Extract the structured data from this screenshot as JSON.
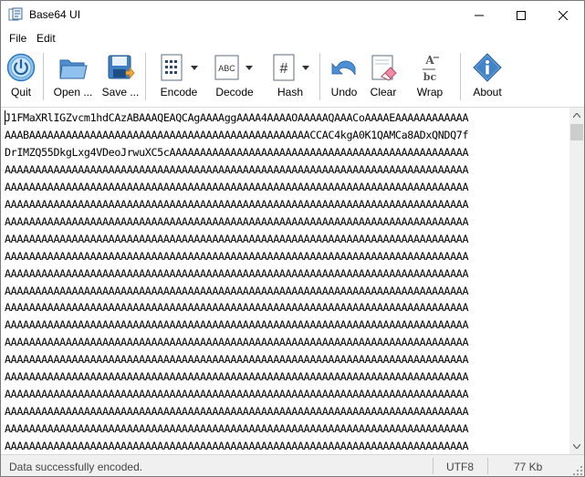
{
  "window": {
    "title": "Base64 UI",
    "app_icon": "base64-app-icon"
  },
  "menu": {
    "items": [
      "File",
      "Edit"
    ]
  },
  "toolbar": {
    "quit_label": "Quit",
    "open_label": "Open ...",
    "save_label": "Save ...",
    "encode_label": "Encode",
    "decode_label": "Decode",
    "hash_label": "Hash",
    "undo_label": "Undo",
    "clear_label": "Clear",
    "wrap_label": "Wrap",
    "about_label": "About"
  },
  "editor": {
    "lines": [
      "J1FMaXRlIGZvcm1hdCAzABAAAQEAQCAgAAAAggAAAA4AAAAOAAAAAQAAACoAAAAEAAAAAAAAAAAA",
      "AAABAAAAAAAAAAAAAAAAAAAAAAAAAAAAAAAAAAAAAAAAAAAAAACCAC4kgA0K1QAMCa8ADxQNDQ7f",
      "DrIMZQ55DkgLxg4VDeoJrwuXC5cAAAAAAAAAAAAAAAAAAAAAAAAAAAAAAAAAAAAAAAAAAAAAAAAA",
      "AAAAAAAAAAAAAAAAAAAAAAAAAAAAAAAAAAAAAAAAAAAAAAAAAAAAAAAAAAAAAAAAAAAAAAAAAAAA",
      "AAAAAAAAAAAAAAAAAAAAAAAAAAAAAAAAAAAAAAAAAAAAAAAAAAAAAAAAAAAAAAAAAAAAAAAAAAAA",
      "AAAAAAAAAAAAAAAAAAAAAAAAAAAAAAAAAAAAAAAAAAAAAAAAAAAAAAAAAAAAAAAAAAAAAAAAAAAA",
      "AAAAAAAAAAAAAAAAAAAAAAAAAAAAAAAAAAAAAAAAAAAAAAAAAAAAAAAAAAAAAAAAAAAAAAAAAAAA",
      "AAAAAAAAAAAAAAAAAAAAAAAAAAAAAAAAAAAAAAAAAAAAAAAAAAAAAAAAAAAAAAAAAAAAAAAAAAAA",
      "AAAAAAAAAAAAAAAAAAAAAAAAAAAAAAAAAAAAAAAAAAAAAAAAAAAAAAAAAAAAAAAAAAAAAAAAAAAA",
      "AAAAAAAAAAAAAAAAAAAAAAAAAAAAAAAAAAAAAAAAAAAAAAAAAAAAAAAAAAAAAAAAAAAAAAAAAAAA",
      "AAAAAAAAAAAAAAAAAAAAAAAAAAAAAAAAAAAAAAAAAAAAAAAAAAAAAAAAAAAAAAAAAAAAAAAAAAAA",
      "AAAAAAAAAAAAAAAAAAAAAAAAAAAAAAAAAAAAAAAAAAAAAAAAAAAAAAAAAAAAAAAAAAAAAAAAAAAA",
      "AAAAAAAAAAAAAAAAAAAAAAAAAAAAAAAAAAAAAAAAAAAAAAAAAAAAAAAAAAAAAAAAAAAAAAAAAAAA",
      "AAAAAAAAAAAAAAAAAAAAAAAAAAAAAAAAAAAAAAAAAAAAAAAAAAAAAAAAAAAAAAAAAAAAAAAAAAAA",
      "AAAAAAAAAAAAAAAAAAAAAAAAAAAAAAAAAAAAAAAAAAAAAAAAAAAAAAAAAAAAAAAAAAAAAAAAAAAA",
      "AAAAAAAAAAAAAAAAAAAAAAAAAAAAAAAAAAAAAAAAAAAAAAAAAAAAAAAAAAAAAAAAAAAAAAAAAAAA",
      "AAAAAAAAAAAAAAAAAAAAAAAAAAAAAAAAAAAAAAAAAAAAAAAAAAAAAAAAAAAAAAAAAAAAAAAAAAAA",
      "AAAAAAAAAAAAAAAAAAAAAAAAAAAAAAAAAAAAAAAAAAAAAAAAAAAAAAAAAAAAAAAAAAAAAAAAAAAA",
      "AAAAAAAAAAAAAAAAAAAAAAAAAAAAAAAAAAAAAAAAAAAAAAAAAAAAAAAAAAAAAAAAAAAAAAAAAAAA",
      "AAAAAAAAAAAAAAAAAAAAAAAAAAAAAAAAAAAAAAAAAAAAAAAAAAAAAAAAAAAAAAAAAAAAAAAAAAAA"
    ]
  },
  "status": {
    "message": "Data successfully encoded.",
    "encoding": "UTF8",
    "size": "77 Kb"
  },
  "colors": {
    "accent_blue": "#1e6fbf",
    "light_blue": "#8ec3ea",
    "status_bg": "#f0f0f0"
  }
}
